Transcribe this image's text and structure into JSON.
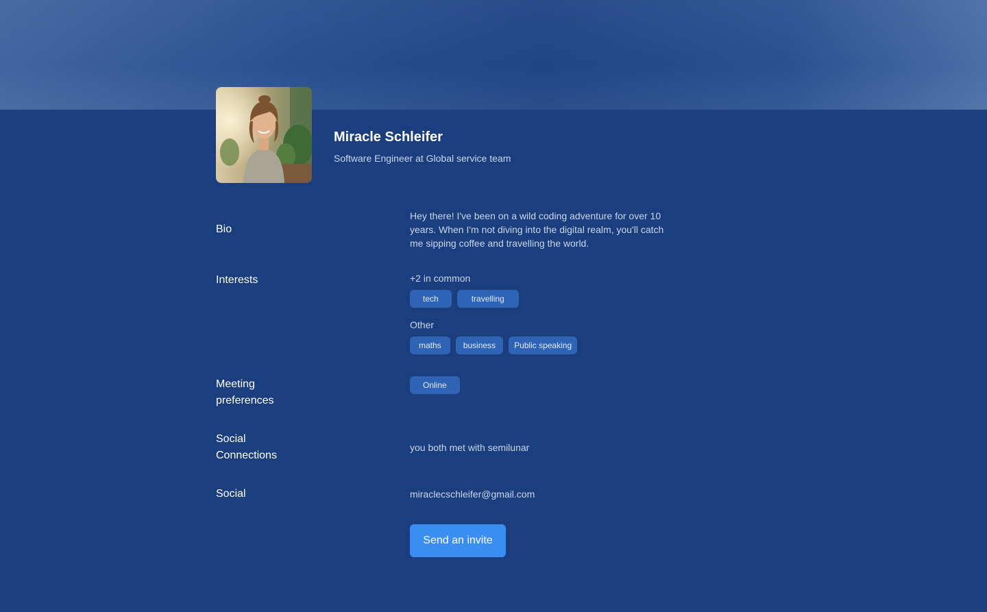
{
  "profile": {
    "name": "Miracle Schleifer",
    "title": "Software Engineer at Global service team",
    "avatar_icon": "profile-photo"
  },
  "sections": {
    "bio": {
      "label": "Bio",
      "text": "Hey there! I've been on a wild coding adventure for over 10 years. When I'm not diving into the digital realm, you'll catch me sipping coffee and travelling the world."
    },
    "interests": {
      "label": "Interests",
      "common_label": "+2 in common",
      "common_tags": [
        "tech",
        "travelling"
      ],
      "other_label": "Other",
      "other_tags": [
        "maths",
        "business",
        "Public speaking"
      ]
    },
    "meeting": {
      "label": "Meeting preferences",
      "tags": [
        "Online"
      ]
    },
    "social_connections": {
      "label": "Social Connections",
      "text": "you both met with semilunar"
    },
    "social": {
      "label": "Social",
      "email": "miraclecschleifer@gmail.com"
    }
  },
  "actions": {
    "invite_label": "Send an invite"
  },
  "colors": {
    "background": "#1b3f7e",
    "tag_bg": "#2f63b6",
    "button": "#3a8ef2"
  }
}
